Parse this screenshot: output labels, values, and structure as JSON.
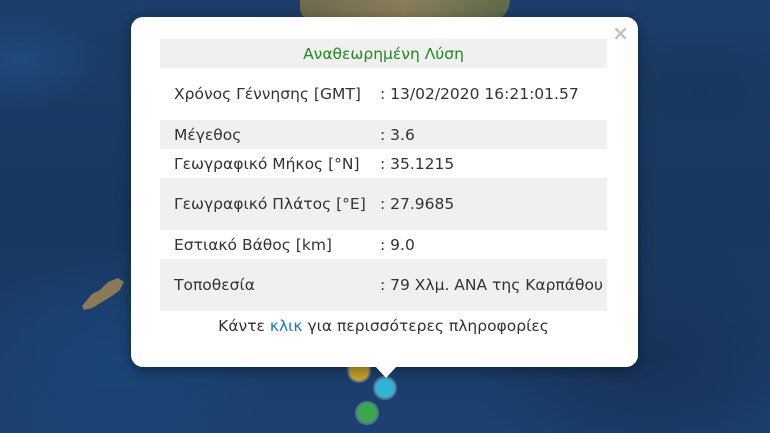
{
  "popup": {
    "title": "Αναθεωρημένη Λύση",
    "rows": [
      {
        "label": "Χρόνος Γέννησης [GMT]",
        "value": ": 13/02/2020 16:21:01.57"
      },
      {
        "label": "Μέγεθος",
        "value": ": 3.6"
      },
      {
        "label": "Γεωγραφικό Μήκος [°N]",
        "value": ": 35.1215"
      },
      {
        "label": "Γεωγραφικό Πλάτος [°E]",
        "value": ": 27.9685"
      },
      {
        "label": "Εστιακό Βάθος [km]",
        "value": ": 9.0"
      },
      {
        "label": "Τοποθεσία",
        "value": ": 79 Χλμ. ΑΝΑ της Καρπάθου"
      }
    ],
    "footer": {
      "prefix": "Κάντε ",
      "link": "κλικ",
      "suffix": " για περισσότερες πληροφορίες"
    },
    "close_symbol": "×"
  },
  "markers": [
    {
      "color": "#c9a227"
    },
    {
      "color": "#2fb4d6"
    },
    {
      "color": "#3aa84a"
    }
  ]
}
